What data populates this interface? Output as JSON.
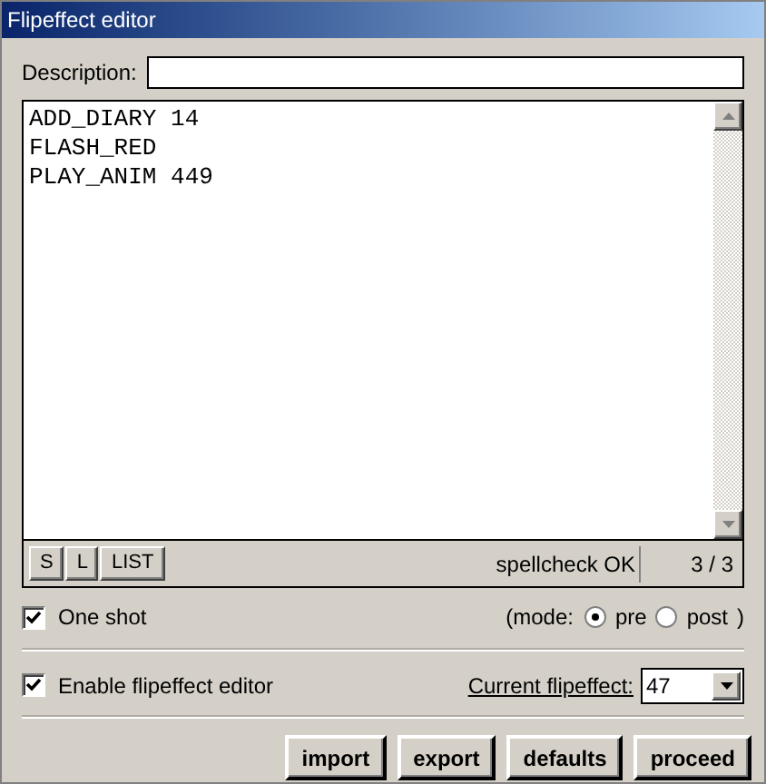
{
  "window": {
    "title": "Flipeffect editor"
  },
  "description": {
    "label": "Description:"
  },
  "editor": {
    "lines": [
      "ADD_DIARY 14",
      "FLASH_RED",
      "PLAY_ANIM 449"
    ]
  },
  "toolbar": {
    "buttons": [
      "S",
      "L",
      "LIST"
    ],
    "status": "spellcheck OK",
    "position": "3 / 3"
  },
  "one_shot": {
    "label": "One shot",
    "checked": true
  },
  "mode": {
    "open": "(mode:",
    "options": [
      {
        "label": "pre",
        "selected": true
      },
      {
        "label": "post",
        "selected": false
      }
    ],
    "close": ")"
  },
  "enable": {
    "label": "Enable flipeffect editor",
    "checked": true
  },
  "current": {
    "label": "Current flipeffect:",
    "value": "47"
  },
  "buttons": [
    "import",
    "export",
    "defaults",
    "proceed"
  ]
}
